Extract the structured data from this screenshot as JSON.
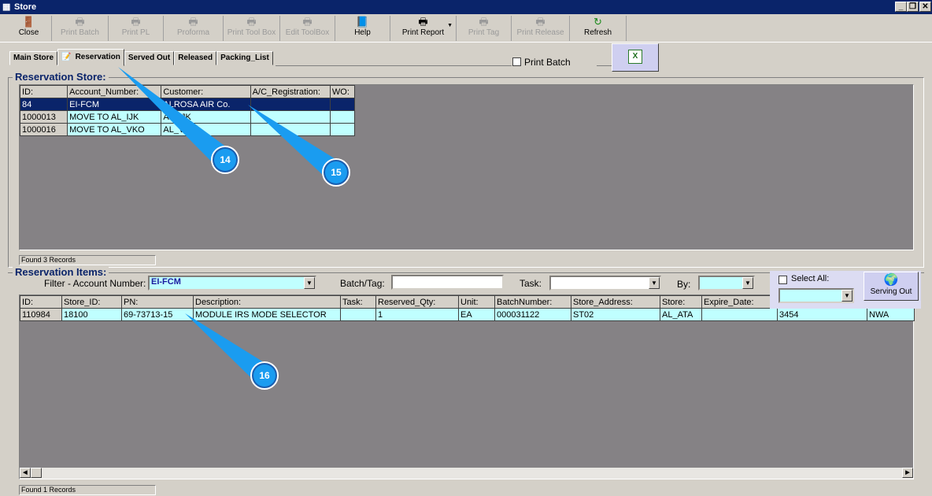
{
  "window": {
    "title": "Store",
    "minimize": "_",
    "restore": "❐",
    "close": "✕"
  },
  "toolbar": [
    {
      "label": "Close",
      "icon": "door-exit-icon",
      "enabled": true
    },
    {
      "label": "Print Batch",
      "icon": "printer-icon",
      "enabled": false
    },
    {
      "label": "Print PL",
      "icon": "printer-icon",
      "enabled": false
    },
    {
      "label": "Proforma",
      "icon": "printer-icon",
      "enabled": false
    },
    {
      "label": "Print Tool Box",
      "icon": "printer-icon",
      "enabled": false
    },
    {
      "label": "Edit ToolBox",
      "icon": "printer-icon",
      "enabled": false
    },
    {
      "label": "Help",
      "icon": "help-book-icon",
      "enabled": true
    },
    {
      "label": "Print Report",
      "icon": "printer-icon",
      "enabled": true
    },
    {
      "label": "Print Tag",
      "icon": "printer-icon",
      "enabled": false
    },
    {
      "label": "Print Release",
      "icon": "printer-icon",
      "enabled": false
    },
    {
      "label": "Refresh",
      "icon": "refresh-icon",
      "enabled": true
    }
  ],
  "tabs": [
    "Main Store",
    "Reservation",
    "Served Out",
    "Released",
    "Packing_List"
  ],
  "active_tab": "Reservation",
  "print_batch_label": "Print Batch",
  "reservation_store": {
    "title": "Reservation Store:",
    "columns": [
      "ID:",
      "Account_Number:",
      "Customer:",
      "A/C_Registration:",
      "WO:"
    ],
    "rows": [
      [
        "84",
        "EI-FCM",
        "ALROSA AIR Co.",
        "",
        ""
      ],
      [
        "1000013",
        "MOVE TO AL_IJK",
        "AL_IJK",
        "",
        ""
      ],
      [
        "1000016",
        "MOVE TO AL_VKO",
        "AL_VKO",
        "",
        ""
      ]
    ],
    "status": "Found 3 Records"
  },
  "reservation_items": {
    "title": "Reservation Items:",
    "filter_label": "Filter - Account Number:",
    "filter_value": "EI-FCM",
    "batch_label": "Batch/Tag:",
    "batch_value": "",
    "task_label": "Task:",
    "by_label": "By:",
    "select_all_label": "Select All:",
    "serving_out_label": "Serving Out",
    "columns": [
      "ID:",
      "Store_ID:",
      "PN:",
      "Description:",
      "Task:",
      "Reserved_Qty:",
      "Unit:",
      "BatchNumber:",
      "Store_Address:",
      "Store:",
      "Expire_Date:",
      "",
      ""
    ],
    "rows": [
      [
        "110984",
        "18100",
        "69-73713-15",
        "MODULE IRS MODE SELECTOR",
        "",
        "1",
        "EA",
        "000031122",
        "ST02",
        "AL_ATA",
        "",
        "3454",
        "NWA"
      ]
    ],
    "status": "Found 1 Records"
  },
  "callouts": [
    "14",
    "15",
    "16"
  ],
  "colors": {
    "titlebar": "#0a246a",
    "grid_bg": "#858285",
    "row": "#c0ffff",
    "callout": "#1a9cf0"
  }
}
